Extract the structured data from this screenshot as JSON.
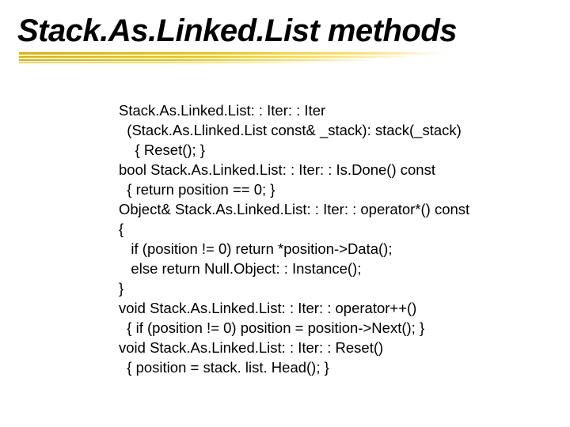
{
  "title": "Stack.As.Linked.List methods",
  "code_lines": [
    "Stack.As.Linked.List: : Iter: : Iter",
    "  (Stack.As.Llinked.List const& _stack): stack(_stack)",
    "    { Reset(); }",
    "bool Stack.As.Linked.List: : Iter: : Is.Done() const",
    "  { return position == 0; }",
    "Object& Stack.As.Linked.List: : Iter: : operator*() const",
    "{",
    "   if (position != 0) return *position->Data();",
    "   else return Null.Object: : Instance();",
    "}",
    "void Stack.As.Linked.List: : Iter: : operator++()",
    "  { if (position != 0) position = position->Next(); }",
    "void Stack.As.Linked.List: : Iter: : Reset()",
    "  { position = stack. list. Head(); }"
  ]
}
